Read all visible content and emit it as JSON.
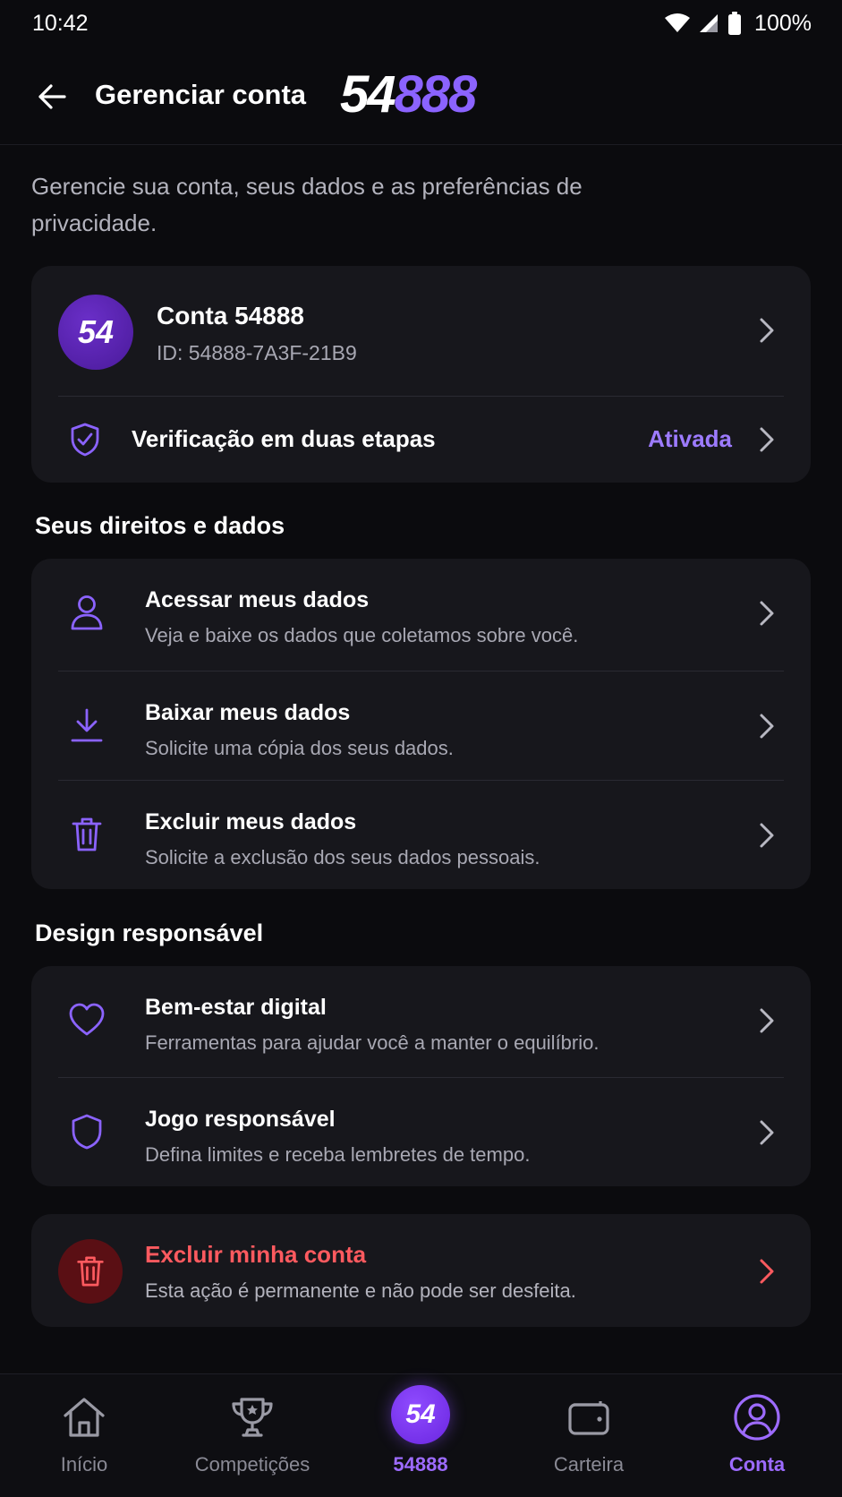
{
  "status_bar": {
    "time": "10:42",
    "battery": "100%"
  },
  "header": {
    "title": "Gerenciar conta",
    "logo_white": "54",
    "logo_purple": "888"
  },
  "intro": "Gerencie sua conta, seus dados e as preferências de privacidade.",
  "account": {
    "avatar_text": "54",
    "name": "Conta 54888",
    "id": "ID: 54888-7A3F-21B9",
    "two_factor_label": "Verificação em duas etapas",
    "two_factor_status": "Ativada"
  },
  "rights": {
    "title": "Seus direitos e dados",
    "items": [
      {
        "title": "Acessar meus dados",
        "subtitle": "Veja e baixe os dados que coletamos sobre você.",
        "icon": "person-icon"
      },
      {
        "title": "Baixar meus dados",
        "subtitle": "Solicite uma cópia dos seus dados.",
        "icon": "download-icon"
      },
      {
        "title": "Excluir meus dados",
        "subtitle": "Solicite a exclusão dos seus dados pessoais.",
        "icon": "trash-icon"
      }
    ]
  },
  "design": {
    "title": "Design responsável",
    "items": [
      {
        "title": "Bem-estar digital",
        "subtitle": "Ferramentas para ajudar você a manter o equilíbrio.",
        "icon": "heart-icon"
      },
      {
        "title": "Jogo responsável",
        "subtitle": "Defina limites e receba lembretes de tempo.",
        "icon": "shield-icon"
      }
    ]
  },
  "delete_account": {
    "title": "Excluir minha conta",
    "subtitle": "Esta ação é permanente e não pode ser desfeita."
  },
  "bottom_nav": [
    {
      "label": "Início",
      "icon": "home-icon"
    },
    {
      "label": "Competições",
      "icon": "trophy-icon"
    },
    {
      "label": "54888",
      "badge": "54"
    },
    {
      "label": "Carteira",
      "icon": "wallet-icon"
    },
    {
      "label": "Conta",
      "icon": "profile-icon",
      "active": true
    }
  ],
  "colors": {
    "accent": "#8b63ff",
    "danger": "#ff5a5f",
    "background": "#0b0b0e",
    "card": "#17171c"
  }
}
